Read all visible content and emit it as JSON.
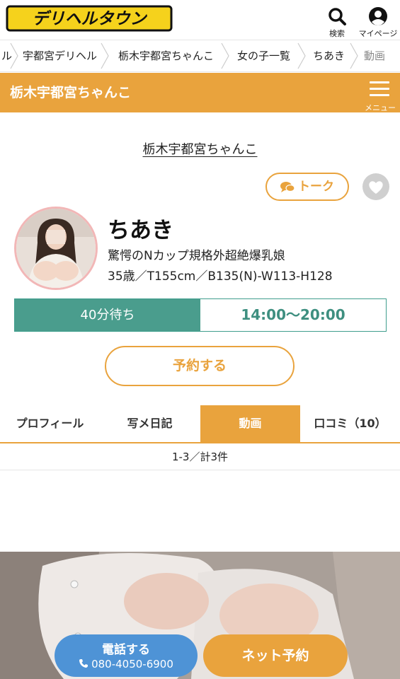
{
  "header": {
    "logo_text": "デリヘルタウン",
    "search_label": "検索",
    "mypage_label": "マイページ"
  },
  "breadcrumb": [
    "ル",
    "宇都宮デリヘル",
    "栃木宇都宮ちゃんこ",
    "女の子一覧",
    "ちあき",
    "動画"
  ],
  "shop_bar": {
    "title": "栃木宇都宮ちゃんこ",
    "menu_label": "メニュー"
  },
  "shop_link": "栃木宇都宮ちゃんこ",
  "talk_button": "トーク",
  "girl": {
    "name": "ちあき",
    "catch": "驚愕のNカップ規格外超絶爆乳娘",
    "spec": "35歳／T155cm／B135(N)-W113-H128"
  },
  "status": {
    "wait": "40分待ち",
    "hours": "14:00〜20:00"
  },
  "reserve_button": "予約する",
  "tabs": [
    {
      "label": "プロフィール",
      "active": false
    },
    {
      "label": "写メ日記",
      "active": false
    },
    {
      "label": "動画",
      "active": true
    },
    {
      "label": "口コミ（10）",
      "active": false
    }
  ],
  "result_count": "1-3／計3件",
  "bottom": {
    "call_label": "電話する",
    "phone": "080-4050-6900",
    "net_label": "ネット予約"
  },
  "colors": {
    "accent": "#e9a33d",
    "teal": "#4a9d8d",
    "call": "#4e93d6"
  },
  "icons": [
    "search-icon",
    "user-icon",
    "menu-icon",
    "chat-icon",
    "heart-icon",
    "phone-icon",
    "chevron-right-icon"
  ]
}
